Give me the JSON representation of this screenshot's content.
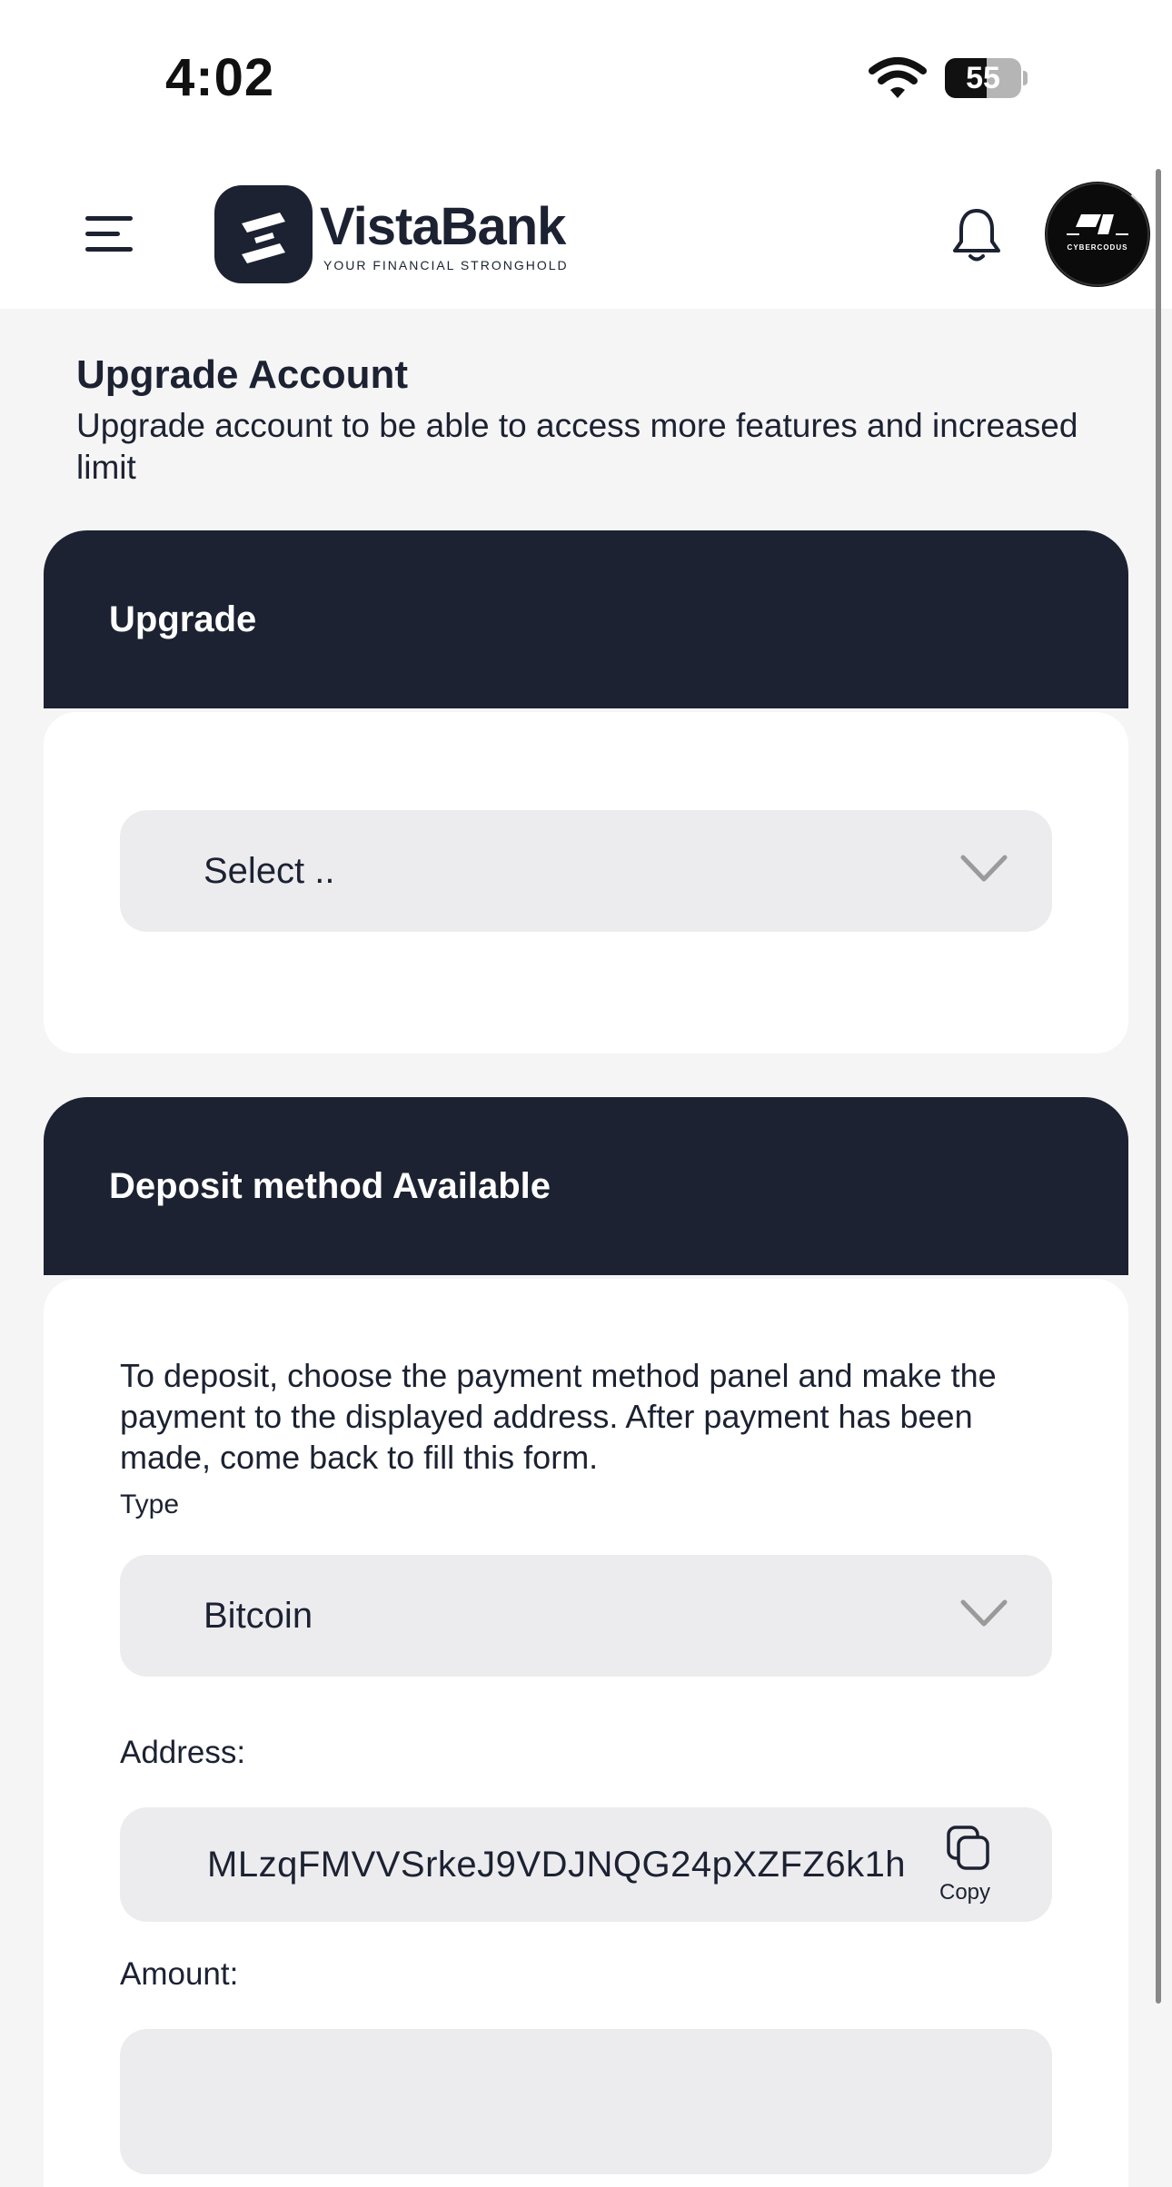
{
  "status_bar": {
    "time": "4:02",
    "battery": "55",
    "battery_level": 0.55
  },
  "header": {
    "brand_name": "VistaBank",
    "brand_tagline": "YOUR FINANCIAL STRONGHOLD",
    "avatar_text": "CYBERCODUS",
    "icons": {
      "menu": "menu-icon",
      "notifications": "bell-icon"
    }
  },
  "page": {
    "title": "Upgrade Account",
    "subtitle": "Upgrade account to be able to access more features and increased limit"
  },
  "upgrade_card": {
    "title": "Upgrade",
    "select_value": "Select .."
  },
  "deposit_card": {
    "title": "Deposit method Available",
    "instructions": "To deposit, choose the payment method panel and make the payment to the displayed address. After payment has been made, come back to fill this form.",
    "type_label": "Type",
    "type_value": "Bitcoin",
    "address_label": "Address:",
    "address_value": "MLzqFMVVSrkeJ9VDJNQG24pXZFZ6k1h",
    "copy_label": "Copy",
    "amount_label": "Amount:",
    "amount_value": ""
  },
  "colors": {
    "primary_dark": "#1c2232",
    "page_background": "#f5f5f5",
    "input_background": "#ececee"
  }
}
